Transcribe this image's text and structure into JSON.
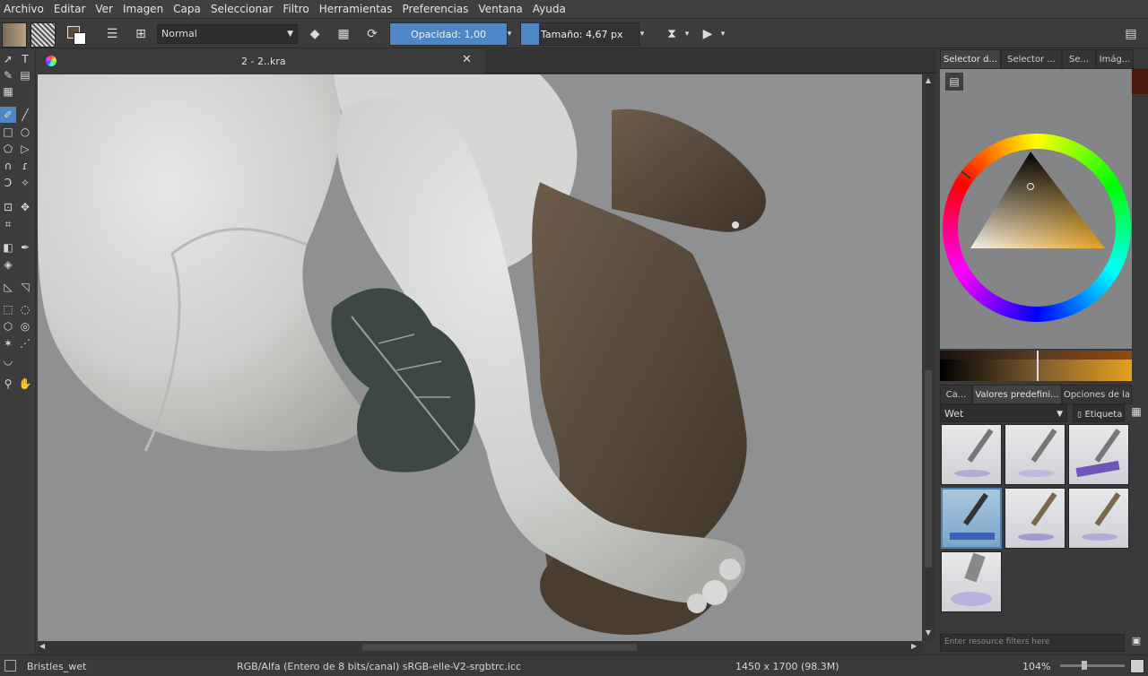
{
  "menu": [
    "Archivo",
    "Editar",
    "Ver",
    "Imagen",
    "Capa",
    "Seleccionar",
    "Filtro",
    "Herramientas",
    "Preferencias",
    "Ventana",
    "Ayuda"
  ],
  "toolbar": {
    "blend_mode": "Normal",
    "opacity_label": "Opacidad:",
    "opacity_value": "1,00",
    "size_label": "Tamaño:",
    "size_value": "4,67 px"
  },
  "document": {
    "tab_title": "2 - 2..kra"
  },
  "dock": {
    "top_tabs": [
      "Selector d...",
      "Selector ...",
      "Se...",
      "Imág..."
    ],
    "bottom_tabs": [
      "Ca...",
      "Valores predefini...",
      "Opciones de la ..."
    ],
    "preset_tag": "Wet",
    "tag_label": "Etiqueta",
    "filter_placeholder": "Enter resource filters here"
  },
  "status": {
    "brush": "Bristles_wet",
    "color_model": "RGB/Alfa (Entero de 8 bits/canal)  sRGB-elle-V2-srgbtrc.icc",
    "dimensions": "1450 x 1700 (98.3M)",
    "zoom": "104%"
  },
  "colors": {
    "canvas_bg": "#8f9092",
    "ui_bg": "#3a3a3a",
    "accent": "#4f86c6",
    "foreground_color": "#5a4a3c",
    "selected_hue": "#e7a020"
  }
}
